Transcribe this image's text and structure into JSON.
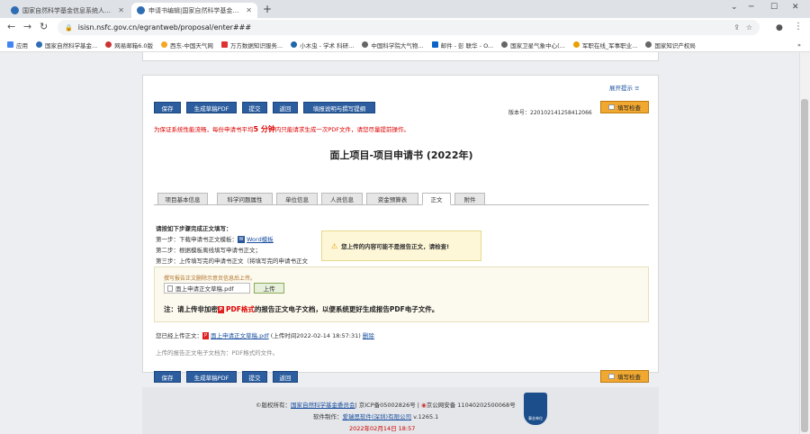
{
  "browser": {
    "tabs": [
      {
        "title": "国家自然科学基金信息系统人员登录"
      },
      {
        "title": "申请书编辑|国家自然科学基金管理"
      }
    ],
    "url": "isisn.nsfc.gov.cn/egrantweb/proposal/enter###",
    "bookmarks": [
      "应用",
      "国家自然科学基金...",
      "网易邮箱6.0版",
      "西东-中国天气网",
      "万方数据知识服务...",
      "小木虫 - 学术 科研...",
      "中国科学院大气物...",
      "邮件 - 彭 联华 - O...",
      "国家卫星气象中心(...",
      "军职在线_军事职业...",
      "国家知识产权局"
    ],
    "more": "»"
  },
  "page": {
    "expand_tip": "展开提示 ≡",
    "toolbar": {
      "save": "保存",
      "gen_pdf": "生成草稿PDF",
      "submit": "提交",
      "back": "返回",
      "help": "填报说明与撰写提纲",
      "check": "填写检查"
    },
    "serial": "版本号：220102141258412066",
    "notice": "为保证系统性能流畅，每份申请书平均",
    "notice_num": "5 分钟",
    "notice_tail": "内只能请求生成一次PDF文件，请您尽量提前操作。",
    "form_title": "面上项目-项目申请书 (2022年)",
    "tabs": [
      "项目基本信息",
      "科学问题属性",
      "单位信息",
      "人员信息",
      "资金预算表",
      "正文",
      "附件"
    ],
    "active_tab": "正文",
    "steps_title": "请按如下步骤完成正文填写：",
    "step1": "第一步：下载申请书正文模板：",
    "step1_link": "Word模板",
    "step2": "第二步：根据模板离线填写申请书正文；",
    "step3": "第三步：上传填写完的申请书正文（将填写完的申请书正文",
    "alert": "您上传的内容可能不是报告正文，请检查!",
    "upload_hint": "撰写报告正文删除示意页信息后上传。",
    "file_name": "面上申请正文草稿.pdf",
    "upload_btn": "上传",
    "note_pre": "注：请上传非加密",
    "note_pdf": "PDF格式",
    "note_post": "的报告正文电子文档，以便系统更好生成报告PDF电子文件。",
    "uploaded_label": "您已经上传正文：",
    "uploaded_file": "面上申请正文草稿.pdf",
    "uploaded_time": "(上传时间2022-02-14 18:57:31)",
    "delete": "删除",
    "format_hint": "上传的报告正文电子文档为：PDF格式的文件。"
  },
  "footer": {
    "line1_a": "©版权所有：",
    "line1_b": "国家自然科学基金委员会",
    "line1_c": "| 京ICP备05002826号 |",
    "line1_d": "京公网安备 11040202500068号",
    "line2_a": "软件制作：",
    "line2_b": "爱瑞思软件(深圳)有限公司",
    "line2_c": "v.1265.1",
    "date": "2022年02月14日 18:57",
    "badge": "事业单位"
  }
}
